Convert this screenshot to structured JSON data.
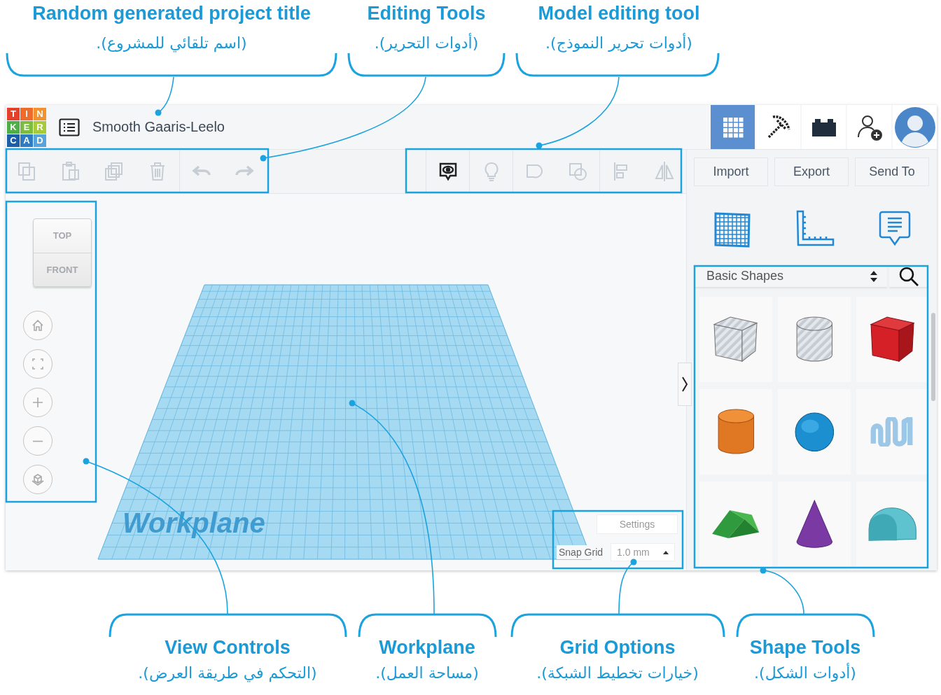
{
  "top_callouts": {
    "project_title": {
      "title": "Random generated project title",
      "subtitle": "(اسم تلقائي للمشروع)."
    },
    "editing_tools": {
      "title": "Editing Tools",
      "subtitle": "(أدوات التحرير)."
    },
    "model_tools": {
      "title": "Model editing tool",
      "subtitle": "(أدوات تحرير النموذج)."
    }
  },
  "app": {
    "logo": [
      {
        "letter": "T",
        "color": "#e5402a"
      },
      {
        "letter": "I",
        "color": "#ef6a2b"
      },
      {
        "letter": "N",
        "color": "#f4912f"
      },
      {
        "letter": "K",
        "color": "#4fae46"
      },
      {
        "letter": "E",
        "color": "#7dbb41"
      },
      {
        "letter": "R",
        "color": "#a7c93c"
      },
      {
        "letter": "C",
        "color": "#1d5ea8"
      },
      {
        "letter": "A",
        "color": "#2f7cc4"
      },
      {
        "letter": "D",
        "color": "#57a3dc"
      }
    ],
    "project_title": "Smooth Gaaris-Leelo",
    "nav": [
      {
        "kind": "grid",
        "selected": true
      },
      {
        "kind": "pickaxe",
        "selected": false
      },
      {
        "kind": "brick",
        "selected": false
      },
      {
        "kind": "add-user",
        "selected": false
      },
      {
        "kind": "avatar",
        "selected": false
      }
    ],
    "editing_tools": [
      {
        "kind": "copy",
        "disabled": true
      },
      {
        "kind": "paste",
        "disabled": true
      },
      {
        "kind": "duplicate",
        "disabled": true
      },
      {
        "kind": "delete",
        "disabled": true
      },
      {
        "kind": "undo",
        "disabled": true
      },
      {
        "kind": "redo",
        "disabled": true
      }
    ],
    "model_tools": [
      {
        "kind": "notes",
        "disabled": false
      },
      {
        "kind": "bulb",
        "disabled": true
      },
      {
        "kind": "merge",
        "disabled": true
      },
      {
        "kind": "group",
        "disabled": true
      },
      {
        "kind": "align",
        "disabled": true
      },
      {
        "kind": "mirror",
        "disabled": true
      }
    ],
    "buttons": [
      "Import",
      "Export",
      "Send To"
    ],
    "panel_tools": [
      {
        "kind": "grid"
      },
      {
        "kind": "ruler"
      },
      {
        "kind": "note"
      }
    ],
    "view_cube": {
      "top": "TOP",
      "front": "FRONT"
    },
    "view_controls": [
      {
        "kind": "home"
      },
      {
        "kind": "fit"
      },
      {
        "kind": "zoom-in"
      },
      {
        "kind": "zoom-out"
      },
      {
        "kind": "perspective"
      }
    ],
    "workplane_label": "Workplane",
    "grid_options": {
      "settings": "Settings",
      "snap_label": "Snap Grid",
      "snap_value": "1.0 mm"
    },
    "library": {
      "category": "Basic Shapes",
      "shapes": [
        {
          "kind": "box-hole"
        },
        {
          "kind": "cylinder-hole"
        },
        {
          "kind": "box"
        },
        {
          "kind": "cylinder"
        },
        {
          "kind": "sphere"
        },
        {
          "kind": "text"
        },
        {
          "kind": "roof"
        },
        {
          "kind": "cone"
        },
        {
          "kind": "round-roof"
        }
      ]
    }
  },
  "bottom_callouts": {
    "view_controls": {
      "title": "View Controls",
      "subtitle": "(التحكم في طريقة العرض)."
    },
    "workplane": {
      "title": "Workplane",
      "subtitle": "(مساحة العمل)."
    },
    "grid_options": {
      "title": "Grid Options",
      "subtitle": "(خيارات تخطيط الشبكة)."
    },
    "shape_tools": {
      "title": "Shape Tools",
      "subtitle": "(أدوات الشكل)."
    }
  }
}
